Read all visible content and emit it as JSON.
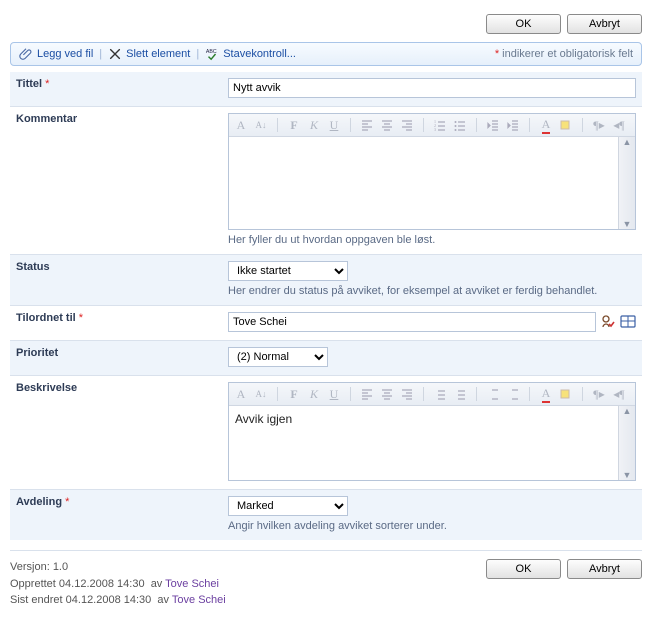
{
  "buttons": {
    "ok": "OK",
    "cancel": "Avbryt"
  },
  "toolbar": {
    "attach": "Legg ved fil",
    "delete": "Slett element",
    "spellcheck": "Stavekontroll...",
    "required_note_prefix": "*",
    "required_note": "indikerer et obligatorisk felt"
  },
  "fields": {
    "title": {
      "label": "Tittel",
      "value": "Nytt avvik"
    },
    "comment": {
      "label": "Kommentar",
      "value": "",
      "help": "Her fyller du ut hvordan oppgaven ble løst."
    },
    "status": {
      "label": "Status",
      "value": "Ikke startet",
      "help": "Her endrer du status på avviket, for eksempel at avviket er ferdig behandlet."
    },
    "assigned": {
      "label": "Tilordnet til",
      "value": "Tove Schei"
    },
    "priority": {
      "label": "Prioritet",
      "value": "(2) Normal"
    },
    "description": {
      "label": "Beskrivelse",
      "value": "Avvik igjen"
    },
    "department": {
      "label": "Avdeling",
      "value": "Marked",
      "help": "Angir hvilken avdeling avviket sorterer under."
    }
  },
  "meta": {
    "version_label": "Versjon:",
    "version": "1.0",
    "created_label": "Opprettet",
    "created_at": "04.12.2008 14:30",
    "by_label": "av",
    "created_by": "Tove Schei",
    "modified_label": "Sist endret",
    "modified_at": "04.12.2008 14:30",
    "modified_by": "Tove Schei"
  }
}
